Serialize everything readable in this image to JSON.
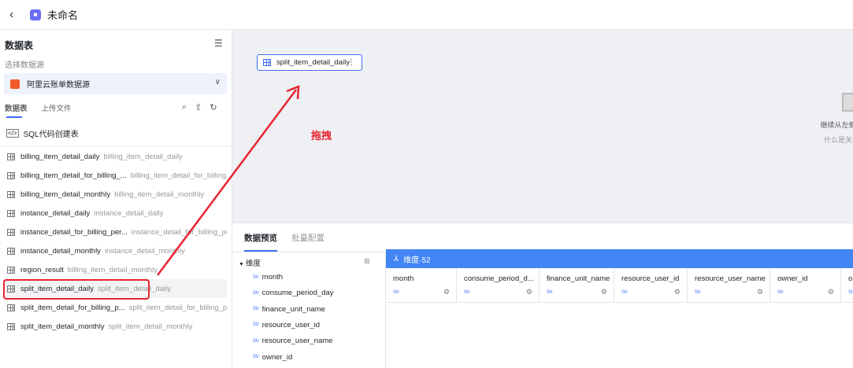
{
  "header": {
    "title": "未命名"
  },
  "left": {
    "title": "数据表",
    "source_label": "选择数据源",
    "source": "阿里云账单数据源",
    "tabs": [
      "数据表",
      "上传文件"
    ],
    "sql": "SQL代码创建表",
    "tables": [
      {
        "name": "billing_item_detail_daily",
        "alias": "billing_item_detail_daily"
      },
      {
        "name": "billing_item_detail_for_billing_...",
        "alias": "billing_item_detail_for_billing_..."
      },
      {
        "name": "billing_item_detail_monthly",
        "alias": "billing_item_detail_monthly"
      },
      {
        "name": "instance_detail_daily",
        "alias": "instance_detail_daily"
      },
      {
        "name": "instance_detail_for_billing_per...",
        "alias": "instance_detail_for_billing_per..."
      },
      {
        "name": "instance_detail_monthly",
        "alias": "instance_detail_monthly"
      },
      {
        "name": "region_result",
        "alias": "billing_item_detail_monthly"
      },
      {
        "name": "split_item_detail_daily",
        "alias": "split_item_detail_daily"
      },
      {
        "name": "split_item_detail_for_billing_p...",
        "alias": "split_item_detail_for_billing_p..."
      },
      {
        "name": "split_item_detail_monthly",
        "alias": "split_item_detail_monthly"
      }
    ]
  },
  "canvas": {
    "node": "split_item_detail_daily",
    "annotation": "拖拽",
    "empty_line1": "继续从左侧",
    "empty_line2": "什么是关"
  },
  "bottom": {
    "tabs": [
      "数据预览",
      "批量配置"
    ],
    "tree_header": "维度",
    "str": "Str",
    "fields": [
      "month",
      "consume_period_day",
      "finance_unit_name",
      "resource_user_id",
      "resource_user_name",
      "owner_id"
    ],
    "grid_header": "维度·52",
    "columns": [
      "month",
      "consume_period_d...",
      "finance_unit_name",
      "resource_user_id",
      "resource_user_name",
      "owner_id",
      "o"
    ]
  }
}
